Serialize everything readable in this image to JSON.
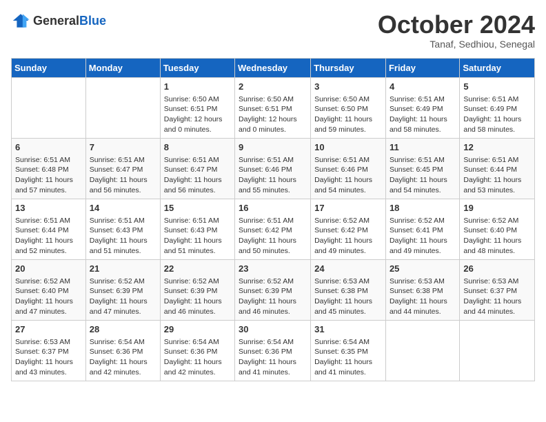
{
  "header": {
    "logo_general": "General",
    "logo_blue": "Blue",
    "month_title": "October 2024",
    "location": "Tanaf, Sedhiou, Senegal"
  },
  "weekdays": [
    "Sunday",
    "Monday",
    "Tuesday",
    "Wednesday",
    "Thursday",
    "Friday",
    "Saturday"
  ],
  "weeks": [
    [
      {
        "day": "",
        "info": ""
      },
      {
        "day": "",
        "info": ""
      },
      {
        "day": "1",
        "info": "Sunrise: 6:50 AM\nSunset: 6:51 PM\nDaylight: 12 hours and 0 minutes."
      },
      {
        "day": "2",
        "info": "Sunrise: 6:50 AM\nSunset: 6:51 PM\nDaylight: 12 hours and 0 minutes."
      },
      {
        "day": "3",
        "info": "Sunrise: 6:50 AM\nSunset: 6:50 PM\nDaylight: 11 hours and 59 minutes."
      },
      {
        "day": "4",
        "info": "Sunrise: 6:51 AM\nSunset: 6:49 PM\nDaylight: 11 hours and 58 minutes."
      },
      {
        "day": "5",
        "info": "Sunrise: 6:51 AM\nSunset: 6:49 PM\nDaylight: 11 hours and 58 minutes."
      }
    ],
    [
      {
        "day": "6",
        "info": "Sunrise: 6:51 AM\nSunset: 6:48 PM\nDaylight: 11 hours and 57 minutes."
      },
      {
        "day": "7",
        "info": "Sunrise: 6:51 AM\nSunset: 6:47 PM\nDaylight: 11 hours and 56 minutes."
      },
      {
        "day": "8",
        "info": "Sunrise: 6:51 AM\nSunset: 6:47 PM\nDaylight: 11 hours and 56 minutes."
      },
      {
        "day": "9",
        "info": "Sunrise: 6:51 AM\nSunset: 6:46 PM\nDaylight: 11 hours and 55 minutes."
      },
      {
        "day": "10",
        "info": "Sunrise: 6:51 AM\nSunset: 6:46 PM\nDaylight: 11 hours and 54 minutes."
      },
      {
        "day": "11",
        "info": "Sunrise: 6:51 AM\nSunset: 6:45 PM\nDaylight: 11 hours and 54 minutes."
      },
      {
        "day": "12",
        "info": "Sunrise: 6:51 AM\nSunset: 6:44 PM\nDaylight: 11 hours and 53 minutes."
      }
    ],
    [
      {
        "day": "13",
        "info": "Sunrise: 6:51 AM\nSunset: 6:44 PM\nDaylight: 11 hours and 52 minutes."
      },
      {
        "day": "14",
        "info": "Sunrise: 6:51 AM\nSunset: 6:43 PM\nDaylight: 11 hours and 51 minutes."
      },
      {
        "day": "15",
        "info": "Sunrise: 6:51 AM\nSunset: 6:43 PM\nDaylight: 11 hours and 51 minutes."
      },
      {
        "day": "16",
        "info": "Sunrise: 6:51 AM\nSunset: 6:42 PM\nDaylight: 11 hours and 50 minutes."
      },
      {
        "day": "17",
        "info": "Sunrise: 6:52 AM\nSunset: 6:42 PM\nDaylight: 11 hours and 49 minutes."
      },
      {
        "day": "18",
        "info": "Sunrise: 6:52 AM\nSunset: 6:41 PM\nDaylight: 11 hours and 49 minutes."
      },
      {
        "day": "19",
        "info": "Sunrise: 6:52 AM\nSunset: 6:40 PM\nDaylight: 11 hours and 48 minutes."
      }
    ],
    [
      {
        "day": "20",
        "info": "Sunrise: 6:52 AM\nSunset: 6:40 PM\nDaylight: 11 hours and 47 minutes."
      },
      {
        "day": "21",
        "info": "Sunrise: 6:52 AM\nSunset: 6:39 PM\nDaylight: 11 hours and 47 minutes."
      },
      {
        "day": "22",
        "info": "Sunrise: 6:52 AM\nSunset: 6:39 PM\nDaylight: 11 hours and 46 minutes."
      },
      {
        "day": "23",
        "info": "Sunrise: 6:52 AM\nSunset: 6:39 PM\nDaylight: 11 hours and 46 minutes."
      },
      {
        "day": "24",
        "info": "Sunrise: 6:53 AM\nSunset: 6:38 PM\nDaylight: 11 hours and 45 minutes."
      },
      {
        "day": "25",
        "info": "Sunrise: 6:53 AM\nSunset: 6:38 PM\nDaylight: 11 hours and 44 minutes."
      },
      {
        "day": "26",
        "info": "Sunrise: 6:53 AM\nSunset: 6:37 PM\nDaylight: 11 hours and 44 minutes."
      }
    ],
    [
      {
        "day": "27",
        "info": "Sunrise: 6:53 AM\nSunset: 6:37 PM\nDaylight: 11 hours and 43 minutes."
      },
      {
        "day": "28",
        "info": "Sunrise: 6:54 AM\nSunset: 6:36 PM\nDaylight: 11 hours and 42 minutes."
      },
      {
        "day": "29",
        "info": "Sunrise: 6:54 AM\nSunset: 6:36 PM\nDaylight: 11 hours and 42 minutes."
      },
      {
        "day": "30",
        "info": "Sunrise: 6:54 AM\nSunset: 6:36 PM\nDaylight: 11 hours and 41 minutes."
      },
      {
        "day": "31",
        "info": "Sunrise: 6:54 AM\nSunset: 6:35 PM\nDaylight: 11 hours and 41 minutes."
      },
      {
        "day": "",
        "info": ""
      },
      {
        "day": "",
        "info": ""
      }
    ]
  ]
}
